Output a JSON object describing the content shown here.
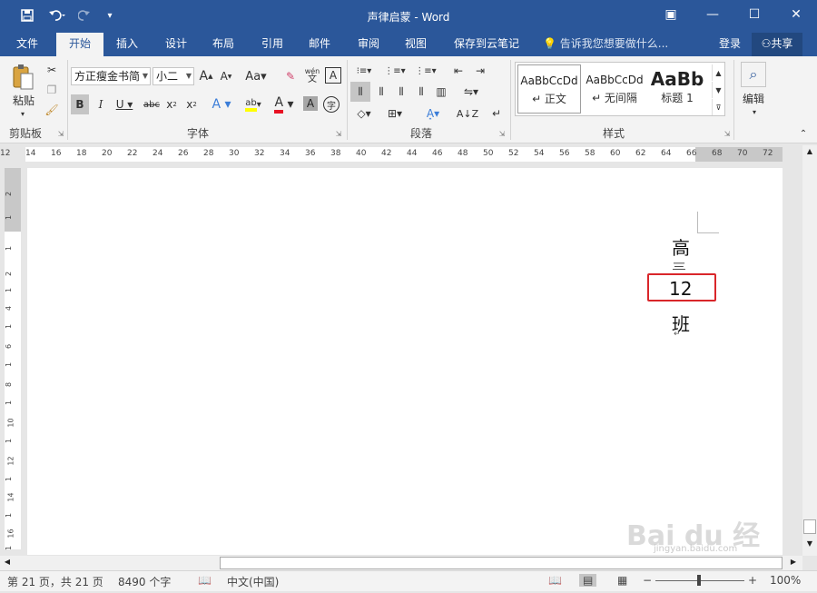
{
  "title": "声律启蒙 - Word",
  "window_controls": {
    "ribbon_display": "▣",
    "minimize": "—",
    "maximize": "☐",
    "close": "✕"
  },
  "tabs": [
    "文件",
    "开始",
    "插入",
    "设计",
    "布局",
    "引用",
    "邮件",
    "审阅",
    "视图",
    "保存到云笔记"
  ],
  "tell_me": "告诉我您想要做什么...",
  "signin": "登录",
  "share": "共享",
  "ribbon": {
    "paste": "粘贴",
    "font_name": "方正瘦金书简",
    "font_size": "小二",
    "clipboard_label": "剪贴板",
    "font_label": "字体",
    "paragraph_label": "段落",
    "styles_label": "样式",
    "edit_label": "编辑",
    "styles": [
      {
        "preview": "AaBbCcDd",
        "name": "↵ 正文"
      },
      {
        "preview": "AaBbCcDd",
        "name": "↵ 无间隔"
      },
      {
        "preview": "AaBb",
        "name": "标题 1"
      }
    ]
  },
  "ruler_numbers": [
    "12",
    "14",
    "16",
    "18",
    "20",
    "22",
    "24",
    "26",
    "28",
    "30",
    "32",
    "34",
    "36",
    "38",
    "40",
    "42",
    "44",
    "46",
    "48",
    "50",
    "52",
    "54",
    "56",
    "58",
    "60",
    "62",
    "64",
    "66",
    "68",
    "70",
    "72"
  ],
  "vruler_numbers": [
    "2",
    "1",
    "1",
    "2",
    "1",
    "4",
    "1",
    "6",
    "1",
    "8",
    "1",
    "10",
    "1",
    "12",
    "1",
    "14",
    "1",
    "16",
    "1"
  ],
  "document": {
    "chars": [
      "高",
      "三",
      "12",
      "班"
    ],
    "para_mark": "↵"
  },
  "status": {
    "page": "第 21 页，共 21 页",
    "words": "8490 个字",
    "language": "中文(中国)",
    "zoom": "100%"
  },
  "accent_colors": {
    "title_bar": "#2b579a",
    "highlight_box": "#d9262a"
  },
  "watermark": {
    "text": "Bai du 经验",
    "url": "jingyan.baidu.com"
  }
}
